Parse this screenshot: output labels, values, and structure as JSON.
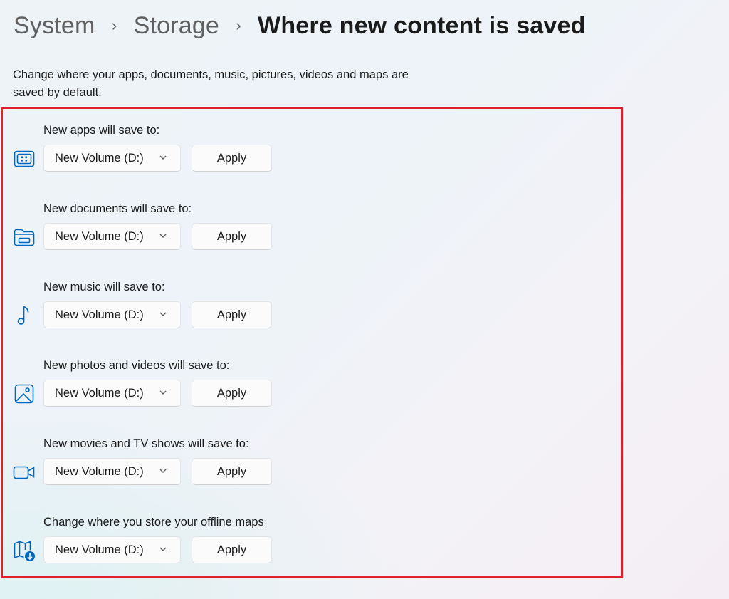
{
  "breadcrumb": {
    "items": [
      "System",
      "Storage"
    ],
    "current": "Where new content is saved",
    "separator": "›"
  },
  "description": "Change where your apps, documents, music, pictures, videos and maps are saved by default.",
  "colors": {
    "highlight_border": "#e0202c",
    "icon_accent": "#0067c0"
  },
  "rows": [
    {
      "label": "New apps will save to:",
      "icon": "apps-icon",
      "selected": "New Volume (D:)",
      "apply_label": "Apply"
    },
    {
      "label": "New documents will save to:",
      "icon": "folder-icon",
      "selected": "New Volume (D:)",
      "apply_label": "Apply"
    },
    {
      "label": "New music will save to:",
      "icon": "music-note-icon",
      "selected": "New Volume (D:)",
      "apply_label": "Apply"
    },
    {
      "label": "New photos and videos will save to:",
      "icon": "photo-icon",
      "selected": "New Volume (D:)",
      "apply_label": "Apply"
    },
    {
      "label": "New movies and TV shows will save to:",
      "icon": "video-camera-icon",
      "selected": "New Volume (D:)",
      "apply_label": "Apply"
    },
    {
      "label": "Change where you store your offline maps",
      "icon": "map-download-icon",
      "selected": "New Volume (D:)",
      "apply_label": "Apply"
    }
  ]
}
